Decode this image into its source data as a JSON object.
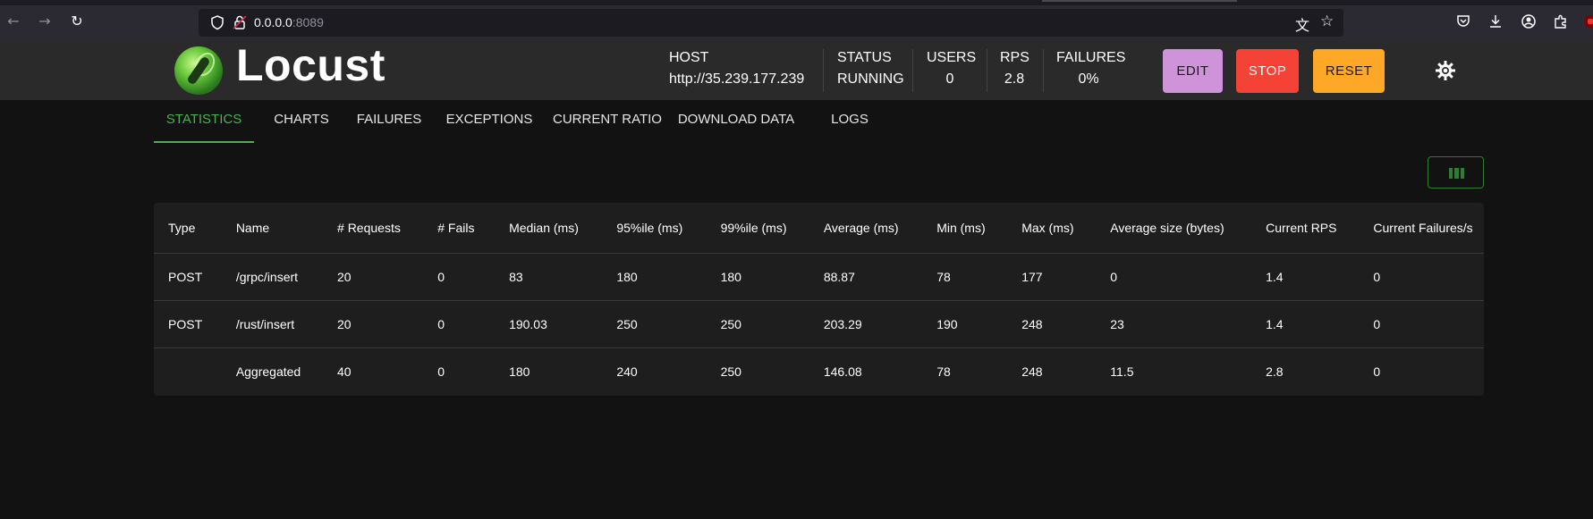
{
  "browser": {
    "url_host": "0.0.0.0",
    "url_port": ":8089",
    "icons": [
      "back-icon",
      "forward-icon",
      "reload-icon",
      "shield-icon",
      "lock-icon",
      "translate-icon",
      "bookmark-star-icon",
      "pocket-icon",
      "download-icon",
      "account-icon",
      "extensions-icon",
      "ublock-icon"
    ]
  },
  "app": {
    "brand": "Locust",
    "stats": {
      "host_label": "HOST",
      "host_value": "http://35.239.177.239",
      "status_label": "STATUS",
      "status_value": "RUNNING",
      "users_label": "USERS",
      "users_value": "0",
      "rps_label": "RPS",
      "rps_value": "2.8",
      "failures_label": "FAILURES",
      "failures_value": "0%"
    },
    "buttons": {
      "edit": "EDIT",
      "stop": "STOP",
      "reset": "RESET"
    },
    "colors": {
      "edit": "#ce93d8",
      "stop": "#f44336",
      "reset": "#ffa726",
      "active_tab": "#4caf50"
    }
  },
  "tabs": [
    "STATISTICS",
    "CHARTS",
    "FAILURES",
    "EXCEPTIONS",
    "CURRENT RATIO",
    "DOWNLOAD DATA",
    "LOGS"
  ],
  "active_tab": "STATISTICS",
  "table": {
    "headers": [
      "Type",
      "Name",
      "# Requests",
      "# Fails",
      "Median (ms)",
      "95%ile (ms)",
      "99%ile (ms)",
      "Average (ms)",
      "Min (ms)",
      "Max (ms)",
      "Average size (bytes)",
      "Current RPS",
      "Current Failures/s"
    ],
    "rows": [
      [
        "POST",
        "/grpc/insert",
        "20",
        "0",
        "83",
        "180",
        "180",
        "88.87",
        "78",
        "177",
        "0",
        "1.4",
        "0"
      ],
      [
        "POST",
        "/rust/insert",
        "20",
        "0",
        "190.03",
        "250",
        "250",
        "203.29",
        "190",
        "248",
        "23",
        "1.4",
        "0"
      ],
      [
        "",
        "Aggregated",
        "40",
        "0",
        "180",
        "240",
        "250",
        "146.08",
        "78",
        "248",
        "11.5",
        "2.8",
        "0"
      ]
    ]
  }
}
